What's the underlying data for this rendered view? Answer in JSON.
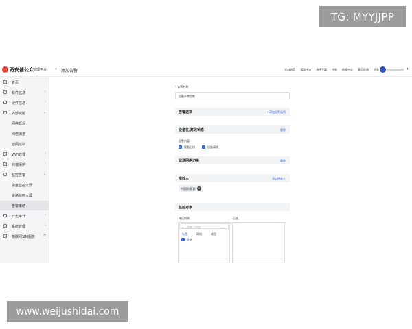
{
  "watermarks": {
    "top": "TG: MYYJJPP",
    "bottom": "www.weijushidai.com"
  },
  "brand": {
    "name": "奇安信公众",
    "sub": "管理平台"
  },
  "header": {
    "title": "添加告警",
    "nav": [
      "定制首页",
      "帮助中心",
      "APP下载",
      "控制",
      "数据中心",
      "意见反馈",
      "消息"
    ]
  },
  "sidebar": {
    "items": [
      {
        "label": "首页",
        "indent": false,
        "arrow": "",
        "active": false
      },
      {
        "label": "软件信息",
        "indent": false,
        "arrow": "›",
        "active": false
      },
      {
        "label": "硬件信息",
        "indent": false,
        "arrow": "›",
        "active": false
      },
      {
        "label": "外部威胁",
        "indent": false,
        "arrow": "⌄",
        "active": false
      },
      {
        "label": "网络概况",
        "indent": true,
        "arrow": "",
        "active": false
      },
      {
        "label": "网络流量",
        "indent": true,
        "arrow": "",
        "active": false
      },
      {
        "label": "访问控制",
        "indent": true,
        "arrow": "",
        "active": false
      },
      {
        "label": "WiFi管理",
        "indent": false,
        "arrow": "›",
        "active": false
      },
      {
        "label": "终端保护",
        "indent": false,
        "arrow": "›",
        "active": false
      },
      {
        "label": "监控告警",
        "indent": false,
        "arrow": "⌄",
        "active": false
      },
      {
        "label": "设备监控大屏",
        "indent": true,
        "arrow": "",
        "active": false
      },
      {
        "label": "链路监控大屏",
        "indent": true,
        "arrow": "",
        "active": false
      },
      {
        "label": "告警策略",
        "indent": true,
        "arrow": "",
        "active": true
      },
      {
        "label": "日志审计",
        "indent": false,
        "arrow": "›",
        "active": false
      },
      {
        "label": "系统管理",
        "indent": false,
        "arrow": "›",
        "active": false
      },
      {
        "label": "物联网SIM服务",
        "indent": false,
        "arrow": "⧉",
        "active": false
      }
    ]
  },
  "form": {
    "name_label": "告警名称",
    "name_value": "设备异常告警",
    "sections": {
      "alert_options": {
        "title": "告警选项",
        "link": "+添加告警选项"
      },
      "device_status": {
        "title": "设备在/离线状态",
        "link": "删除"
      },
      "link_switch": {
        "title": "监测网络切换",
        "link": "删除"
      },
      "receivers": {
        "title": "接收人",
        "link": "添加接收人"
      },
      "targets": {
        "title": "监控对象"
      }
    },
    "alert_content_label": "告警内容",
    "checkbox_online": "设备上线",
    "checkbox_offline": "设备离线",
    "receiver_tag": "中国联通(群)",
    "targets": {
      "left_label": "待选列表",
      "right_label": "已选",
      "search_placeholder": "请输入内容",
      "tabs": [
        "标签",
        "网络",
        "成员"
      ],
      "select_all": "全选"
    }
  }
}
